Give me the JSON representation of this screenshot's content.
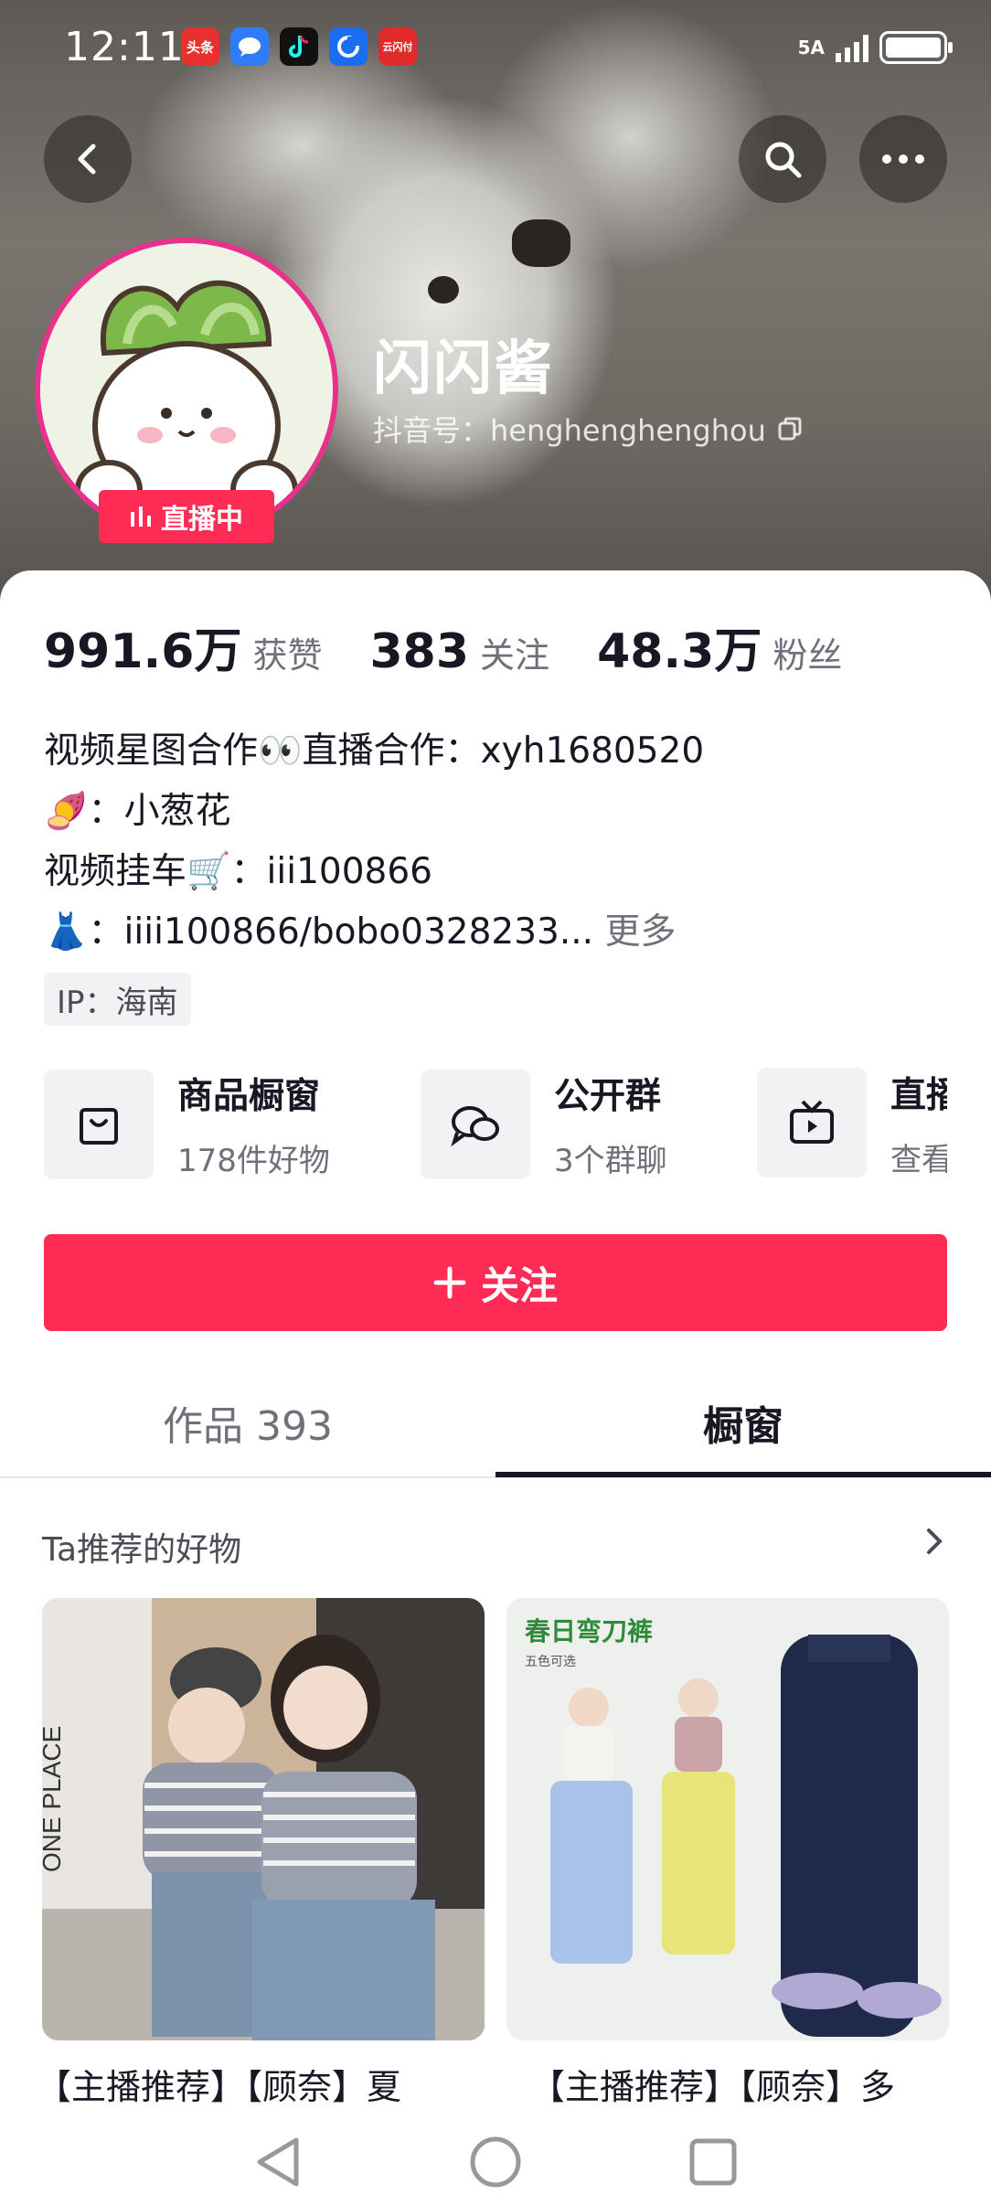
{
  "status_bar": {
    "time": "12:11",
    "apps": [
      {
        "icon": "toutiao-app-icon",
        "label": "头条",
        "color": "#e8312f"
      },
      {
        "icon": "message-app-icon",
        "label": "",
        "color": "#2f7cf6"
      },
      {
        "icon": "tiktok-app-icon",
        "label": "",
        "color": "#111111"
      },
      {
        "icon": "browser-app-icon",
        "label": "",
        "color": "#1a6cf0"
      },
      {
        "icon": "cloudpay-app-icon",
        "label": "云闪付",
        "color": "#e12b2b"
      }
    ],
    "network": "5A"
  },
  "profile": {
    "nickname": "闪闪酱",
    "douyin_id_label": "抖音号：",
    "douyin_id": "henghenghenghou",
    "live_badge": "直播中"
  },
  "stats": [
    {
      "value": "991.6万",
      "label": "获赞"
    },
    {
      "value": "383",
      "label": "关注"
    },
    {
      "value": "48.3万",
      "label": "粉丝"
    }
  ],
  "bio": {
    "line1": "视频星图合作👀直播合作：xyh1680520",
    "line2": "🍠：小葱花",
    "line3": "视频挂车🛒：iii100866",
    "line4": "👗：iiii100866/bobo0328233...",
    "more": "更多"
  },
  "ip": "IP：海南",
  "quick_links": [
    {
      "icon": "shopping-bag-icon",
      "title": "商品橱窗",
      "subtitle": "178件好物"
    },
    {
      "icon": "group-chat-icon",
      "title": "公开群",
      "subtitle": "3个群聊"
    },
    {
      "icon": "tv-icon",
      "title": "直播",
      "subtitle": "查看"
    }
  ],
  "follow_button": "关注",
  "tabs": [
    {
      "label": "作品 393",
      "active": false
    },
    {
      "label": "橱窗",
      "active": true
    }
  ],
  "recommend_title": "Ta推荐的好物",
  "products": [
    {
      "title": "【主播推荐】【顾奈】夏"
    },
    {
      "title": "【主播推荐】【顾奈】多",
      "image_text": "春日弯刀裤",
      "image_subtext": "五色可选"
    }
  ],
  "product1_image_text": "ONE PLACE",
  "colors": {
    "accent": "#fe2c55",
    "live_ring": "#e8318a"
  }
}
